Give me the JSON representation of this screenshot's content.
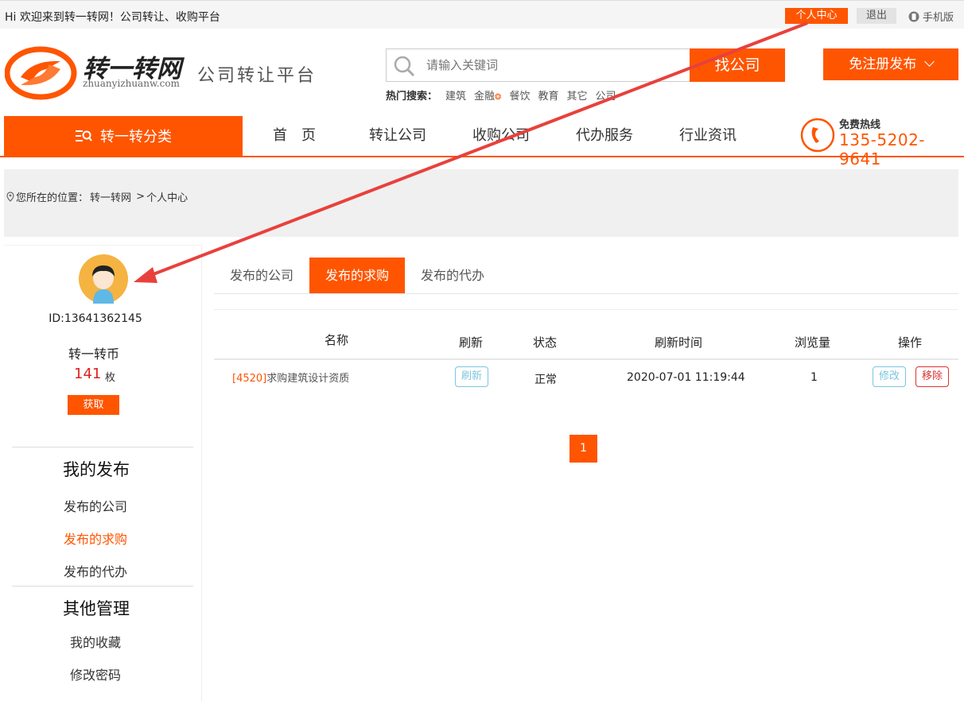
{
  "topbar": {
    "greeting": "Hi 欢迎来到转一转网！公司转让、收购平台",
    "user_center": "个人中心",
    "logout": "退出",
    "mobile": "手机版"
  },
  "header": {
    "logo_text": "转一转网",
    "logo_sub": "zhuanyizhuanw.com",
    "slogan": "公司转让平台",
    "search_placeholder": "请输入关键词",
    "find_button": "找公司",
    "publish_button": "免注册发布",
    "hot_label": "热门搜索：",
    "hot_keywords": [
      "建筑",
      "金融",
      "餐饮",
      "教育",
      "其它",
      "公司"
    ]
  },
  "nav": {
    "category": "转一转分类",
    "items": [
      "首　页",
      "转让公司",
      "收购公司",
      "代办服务",
      "行业资讯"
    ],
    "hotline_label": "免费热线",
    "hotline_number": "135-5202-9641"
  },
  "breadcrumb": {
    "prefix": "您所在的位置：",
    "home": "转一转网",
    "current": "个人中心"
  },
  "sidebar": {
    "user_id": "ID:13641362145",
    "coin_label": "转一转币",
    "coin_count": "141",
    "coin_unit": "枚",
    "get_button": "获取",
    "section1_title": "我的发布",
    "section1_links": [
      "发布的公司",
      "发布的求购",
      "发布的代办"
    ],
    "section2_title": "其他管理",
    "section2_links": [
      "我的收藏",
      "修改密码"
    ]
  },
  "tabs": [
    "发布的公司",
    "发布的求购",
    "发布的代办"
  ],
  "table": {
    "headers": [
      "名称",
      "刷新",
      "状态",
      "刷新时间",
      "浏览量",
      "操作"
    ],
    "rows": [
      {
        "id": "[4520]",
        "name": "求购建筑设计资质",
        "refresh": "刷新",
        "status": "正常",
        "time": "2020-07-01 11:19:44",
        "views": "1",
        "edit": "修改",
        "remove": "移除"
      }
    ]
  },
  "pagination": {
    "current": "1"
  },
  "colors": {
    "accent": "#ff5500",
    "link_blue": "#7ac5e0",
    "danger": "#dd3333"
  }
}
